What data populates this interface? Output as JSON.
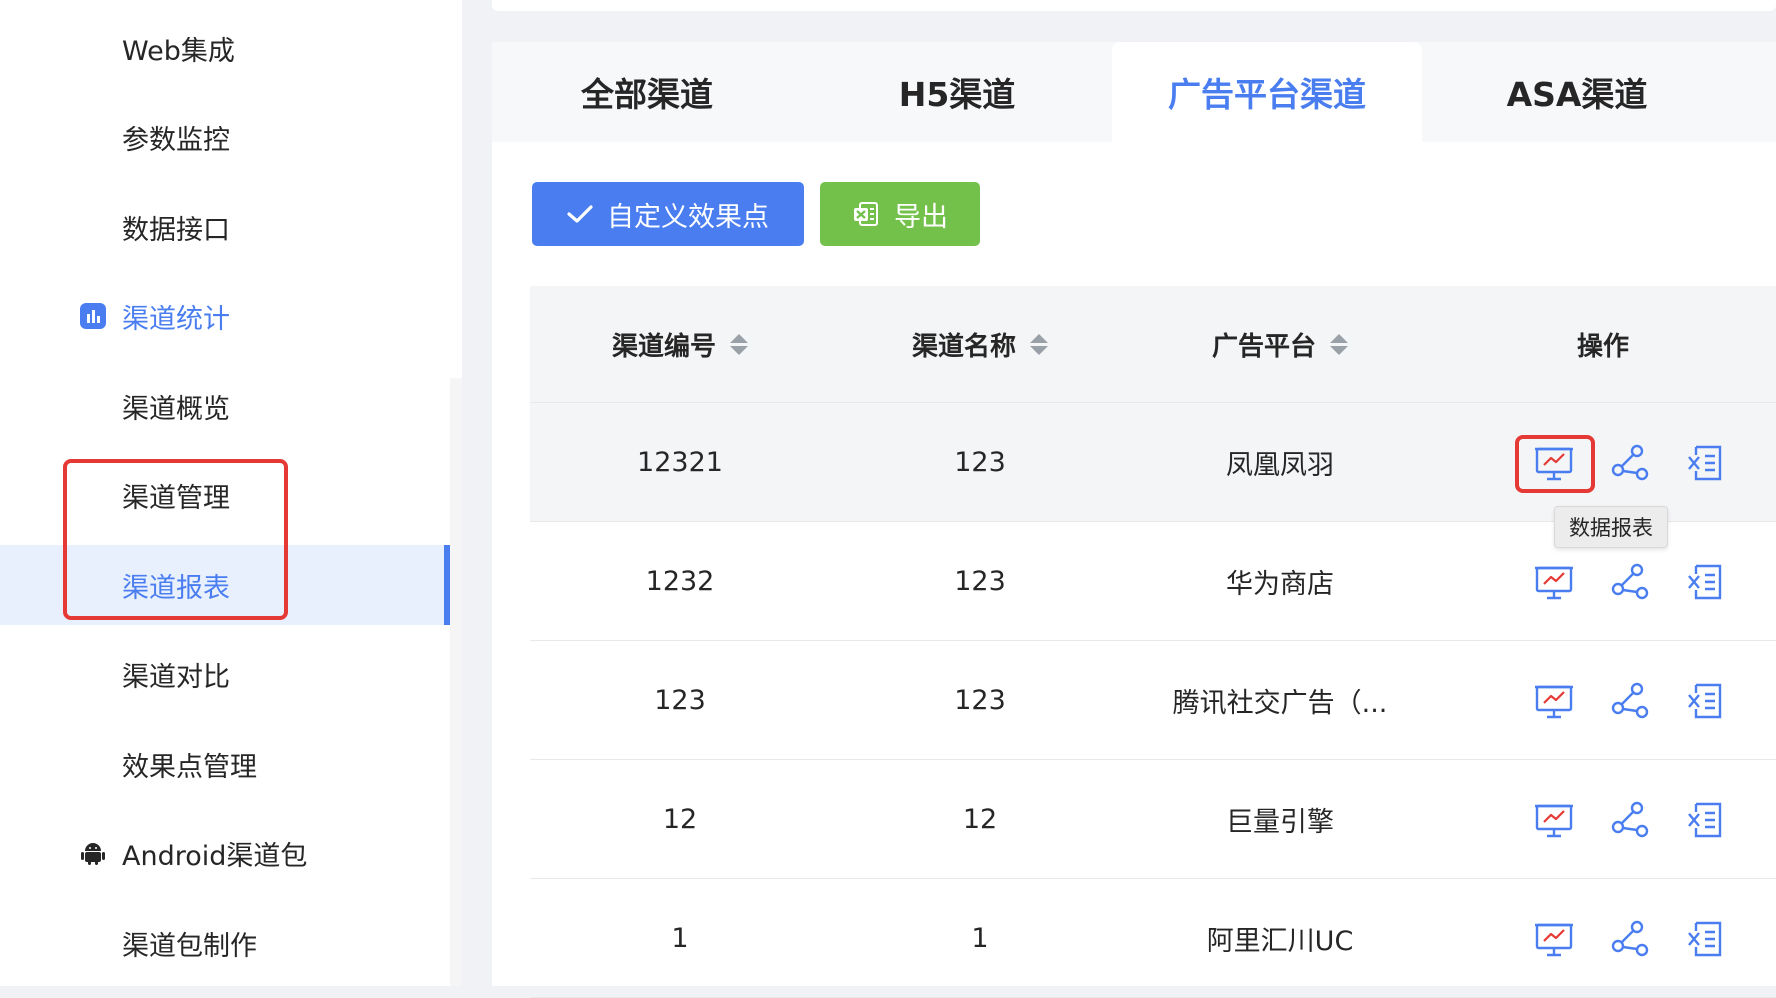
{
  "sidebar": {
    "items": [
      {
        "label": "Web集成"
      },
      {
        "label": "参数监控"
      },
      {
        "label": "数据接口"
      },
      {
        "label": "渠道统计",
        "icon": "bar-chart-icon"
      },
      {
        "label": "渠道概览"
      },
      {
        "label": "渠道管理"
      },
      {
        "label": "渠道报表"
      },
      {
        "label": "渠道对比"
      },
      {
        "label": "效果点管理"
      },
      {
        "label": "Android渠道包",
        "icon": "android-icon"
      },
      {
        "label": "渠道包制作"
      }
    ]
  },
  "tabs": [
    {
      "label": "全部渠道"
    },
    {
      "label": "H5渠道"
    },
    {
      "label": "广告平台渠道"
    },
    {
      "label": "ASA渠道"
    }
  ],
  "toolbar": {
    "custom_label": "自定义效果点",
    "export_label": "导出"
  },
  "table": {
    "columns": [
      "渠道编号",
      "渠道名称",
      "广告平台",
      "操作"
    ],
    "rows": [
      {
        "id": "12321",
        "name": "123",
        "platform": "凤凰凤羽"
      },
      {
        "id": "1232",
        "name": "123",
        "platform": "华为商店"
      },
      {
        "id": "123",
        "name": "123",
        "platform": "腾讯社交广告（..."
      },
      {
        "id": "12",
        "name": "12",
        "platform": "巨量引擎"
      },
      {
        "id": "1",
        "name": "1",
        "platform": "阿里汇川UC"
      }
    ]
  },
  "tooltip": "数据报表",
  "colors": {
    "primary": "#4a7ef0",
    "success": "#73c14b",
    "highlight": "#e53935"
  }
}
